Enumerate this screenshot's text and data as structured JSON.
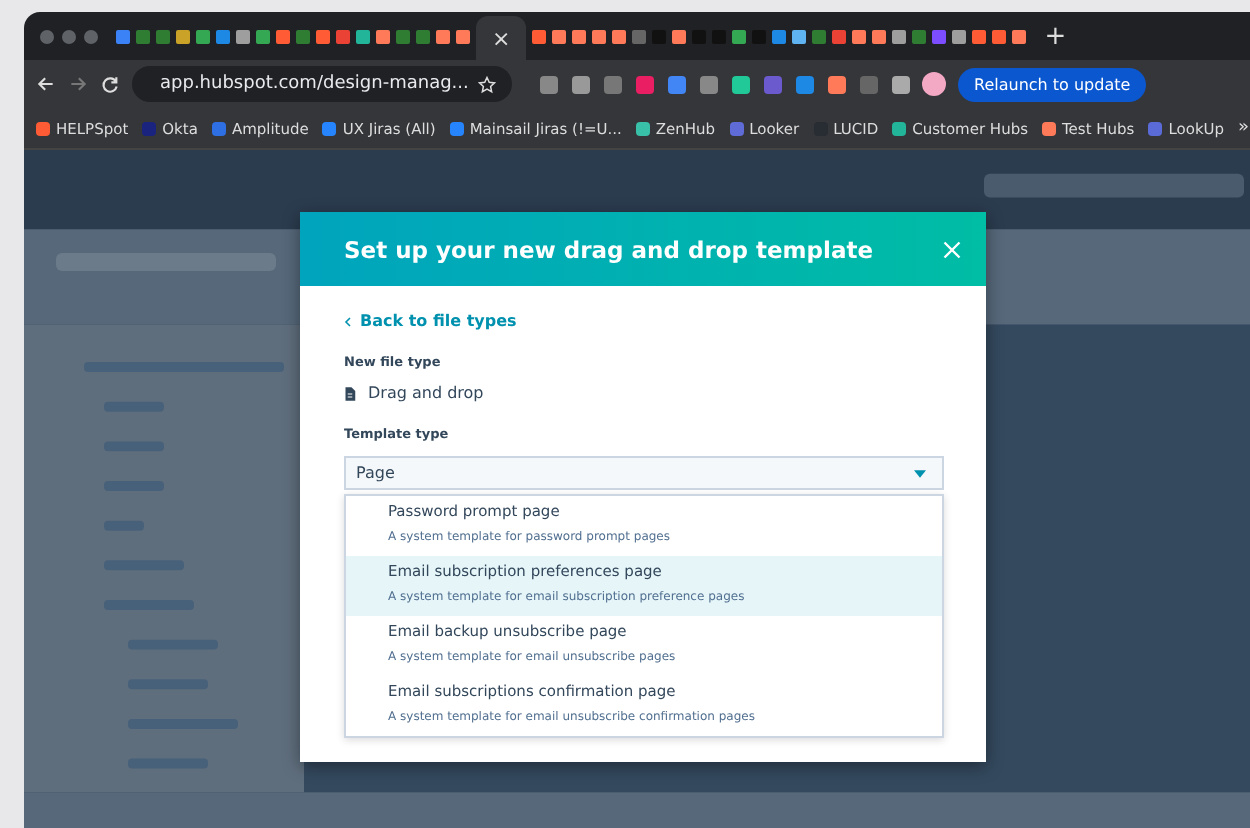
{
  "browser": {
    "close_tab": "×",
    "new_tab": "+",
    "address": "app.hubspot.com/design-manag...",
    "update_button": "Relaunch to update",
    "bookmarks": [
      {
        "label": "HELPSpot",
        "color": "#ff5c35"
      },
      {
        "label": "Okta",
        "color": "#1a237e"
      },
      {
        "label": "Amplitude",
        "color": "#2f6fe4"
      },
      {
        "label": "UX Jiras (All)",
        "color": "#2684ff"
      },
      {
        "label": "Mainsail Jiras (!=U...",
        "color": "#2684ff"
      },
      {
        "label": "ZenHub",
        "color": "#39c0a8"
      },
      {
        "label": "Looker",
        "color": "#5f6bd6"
      },
      {
        "label": "LUCID",
        "color": "#282c33"
      },
      {
        "label": "Customer Hubs",
        "color": "#22b59a"
      },
      {
        "label": "Test Hubs",
        "color": "#ff7a59"
      },
      {
        "label": "LookUp",
        "color": "#5a6bd8"
      }
    ],
    "more_bookmarks": "»"
  },
  "modal": {
    "title": "Set up your new drag and drop template",
    "back_link": "Back to file types",
    "file_type_label": "New file type",
    "file_type": "Drag and drop",
    "template_type_label": "Template type",
    "template_type": "Page",
    "options": [
      {
        "name": "Password prompt page",
        "description": "A system template for password prompt pages",
        "selected": false
      },
      {
        "name": "Email subscription preferences page",
        "description": "A system template for email subscription preference pages",
        "selected": true
      },
      {
        "name": "Email backup unsubscribe page",
        "description": "A system template for email unsubscribe pages",
        "selected": false
      },
      {
        "name": "Email subscriptions confirmation page",
        "description": "A system template for email unsubscribe confirmation pages",
        "selected": false
      }
    ]
  }
}
